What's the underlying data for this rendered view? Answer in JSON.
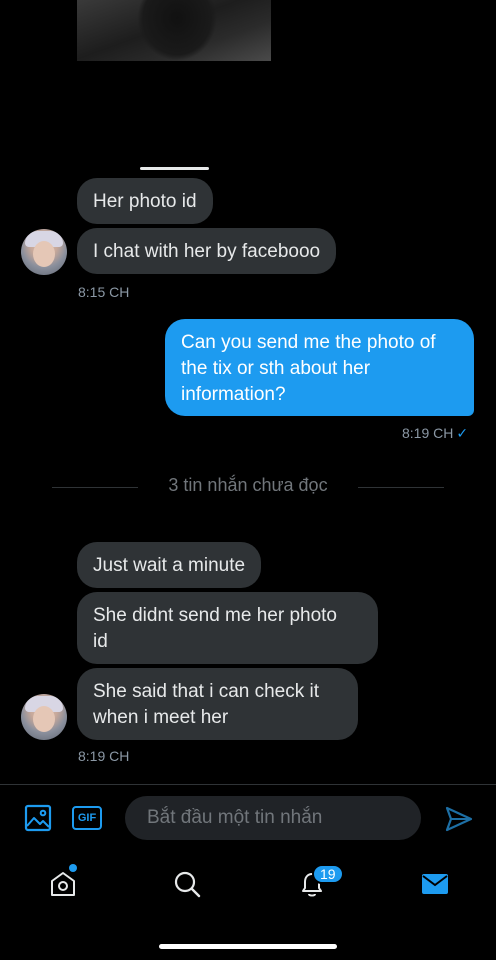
{
  "conversation": {
    "earlier_messages": [
      {
        "text": "Her photo id"
      },
      {
        "text": "I chat with her by facebooo"
      }
    ],
    "earlier_time": "8:15 CH",
    "sent_message": {
      "text": "Can you send me the photo of\nthe tix or sth about her\ninformation?"
    },
    "sent_time": "8:19 CH",
    "sent_status": "✓",
    "unread_divider": "3 tin nhắn chưa đọc",
    "later_messages": [
      {
        "text": "Just wait a minute"
      },
      {
        "text": "She didnt send me her photo\nid"
      },
      {
        "text": "She said that i can check it\nwhen i meet her"
      }
    ],
    "later_time": "8:19 CH"
  },
  "composer": {
    "placeholder": "Bắt đầu một tin nhắn",
    "gif_label": "GIF",
    "icons": [
      "image-icon",
      "gif-icon",
      "send-icon"
    ]
  },
  "tab_bar": {
    "icons": [
      "home-icon",
      "search-icon",
      "notifications-icon",
      "messages-icon"
    ],
    "notifications_badge": "19",
    "home_has_new": true
  },
  "colors": {
    "background": "#000000",
    "incoming_bubble": "#2f3336",
    "outgoing_bubble": "#1d9bf0",
    "accent": "#1d9bf0",
    "muted_text": "#8b98a5"
  }
}
